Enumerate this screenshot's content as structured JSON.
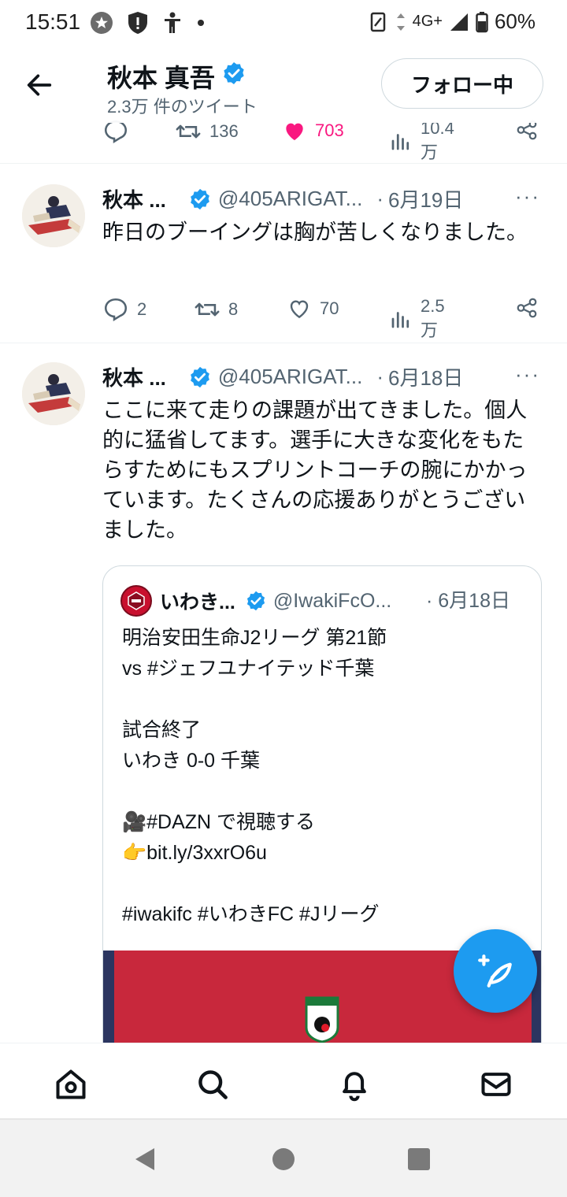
{
  "status_bar": {
    "time": "15:51",
    "network": "4G+",
    "battery": "60%"
  },
  "header": {
    "name": "秋本 真吾",
    "tweet_count": "2.3万 件のツイート",
    "follow_button": "フォロー中"
  },
  "prev_tweet_actions": {
    "retweets": "136",
    "likes": "703",
    "views": "10.4万"
  },
  "tweets": [
    {
      "name": "秋本 ...",
      "handle": "@405ARIGAT...",
      "dot": "·",
      "date": "6月19日",
      "more": "···",
      "text": "昨日のブーイングは胸が苦しくなりました。",
      "replies": "2",
      "retweets": "8",
      "likes": "70",
      "views": "2.5万"
    },
    {
      "name": "秋本 ...",
      "handle": "@405ARIGAT...",
      "dot": "·",
      "date": "6月18日",
      "more": "···",
      "text": "ここに来て走りの課題が出てきました。個人的に猛省してます。選手に大きな変化をもたらすためにもスプリントコーチの腕にかかっています。たくさんの応援ありがとうございました。"
    }
  ],
  "quote": {
    "name": "いわき...",
    "handle": "@IwakiFcO...",
    "date": "· 6月18日",
    "lines": [
      "明治安田生命J2リーグ 第21節",
      "vs #ジェフユナイテッド千葉",
      "",
      "試合終了",
      "いわき 0-0 千葉",
      "",
      "🎥#DAZN で視聴する",
      "👉bit.ly/3xxrO6u",
      "",
      "#iwakifc #いわきFC #Jリーグ"
    ]
  },
  "colors": {
    "accent": "#1d9bf0",
    "like_pink": "#f91880",
    "secondary_text": "#536471",
    "verified": "#1d9bf0"
  },
  "icons": {
    "fab": "compose-tweet-icon",
    "nav": [
      "home-icon",
      "search-icon",
      "notifications-icon",
      "messages-icon"
    ]
  }
}
